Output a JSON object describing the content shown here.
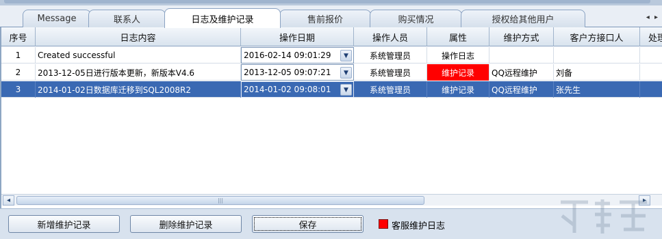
{
  "tabs": [
    {
      "label": "Message"
    },
    {
      "label": "联系人"
    },
    {
      "label": "日志及维护记录",
      "active": true
    },
    {
      "label": "售前报价"
    },
    {
      "label": "购买情况"
    },
    {
      "label": "授权给其他用户"
    }
  ],
  "tab_scroll_label": "◂ ▸",
  "columns": [
    "序号",
    "日志内容",
    "操作日期",
    "操作人员",
    "属性",
    "维护方式",
    "客户方接口人",
    "处理"
  ],
  "rows": [
    {
      "no": "1",
      "content": "Created successful",
      "date": "2016-02-14 09:01:29",
      "operator": "系统管理员",
      "attr": "操作日志",
      "method": "",
      "contact": "",
      "selected": false,
      "attr_red": false
    },
    {
      "no": "2",
      "content": "2013-12-05日进行版本更新，新版本V4.6",
      "date": "2013-12-05 09:07:21",
      "operator": "系统管理员",
      "attr": "维护记录",
      "method": "QQ远程维护",
      "contact": "刘备",
      "selected": false,
      "attr_red": true
    },
    {
      "no": "3",
      "content": "2014-01-02日数据库迁移到SQL2008R2",
      "date": "2014-01-02 09:08:01",
      "operator": "系统管理员",
      "attr": "维护记录",
      "method": "QQ远程维护",
      "contact": "张先生",
      "selected": true,
      "attr_red": false
    }
  ],
  "dropdown_icon": "chevron-down-icon",
  "scrollbar": {
    "left_arrow": "◂",
    "right_arrow": "▸",
    "grip": "|||"
  },
  "buttons": {
    "add": "新增维护记录",
    "delete": "删除维护记录",
    "save": "保存"
  },
  "legend": {
    "label": "客服维护日志",
    "color": "#ff0000"
  },
  "colors": {
    "selection": "#3a69b3",
    "maintenance_highlight": "#ff0000"
  }
}
